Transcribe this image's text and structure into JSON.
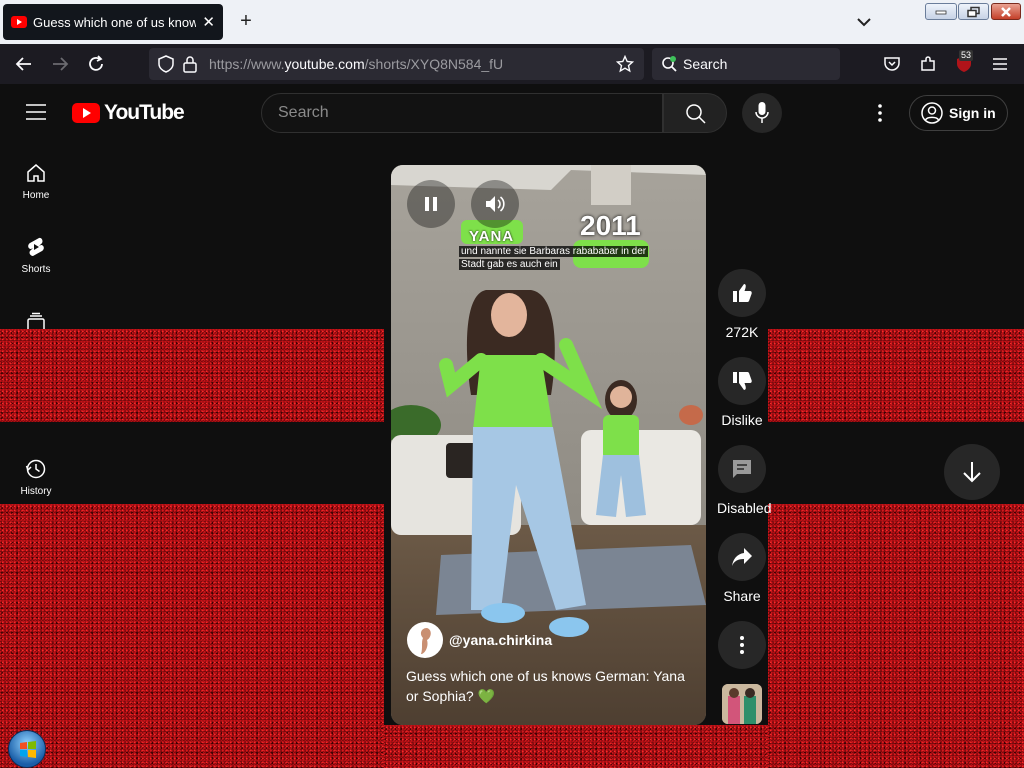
{
  "browser": {
    "tab_title": "Guess which one of us knows G",
    "url_prefix": "https://www.",
    "url_host": "youtube.com",
    "url_path": "/shorts/XYQ8N584_fU",
    "search_placeholder": "Search",
    "extension_badge": "53"
  },
  "youtube": {
    "logo_text": "YouTube",
    "search_placeholder": "Search",
    "signin_label": "Sign in",
    "sidebar": [
      {
        "label": "Home",
        "icon": "home-icon"
      },
      {
        "label": "Shorts",
        "icon": "shorts-icon"
      },
      {
        "label": "History",
        "icon": "history-icon"
      }
    ]
  },
  "short": {
    "overlay_name": "YANA",
    "overlay_year": "2011",
    "caption_line1": "und nannte sie Barbaras rabababar in der",
    "caption_line2": "Stadt gab es auch ein",
    "channel": "@yana.chirkina",
    "title": "Guess which one of us knows German: Yana or Sophia?",
    "title_emoji": "💚",
    "actions": {
      "likes": "272K",
      "dislike": "Dislike",
      "comments": "Disabled",
      "share": "Share"
    }
  },
  "colors": {
    "yt_red": "#ff0000",
    "bg": "#0f0f0f",
    "noise_red": "#b00d12"
  }
}
